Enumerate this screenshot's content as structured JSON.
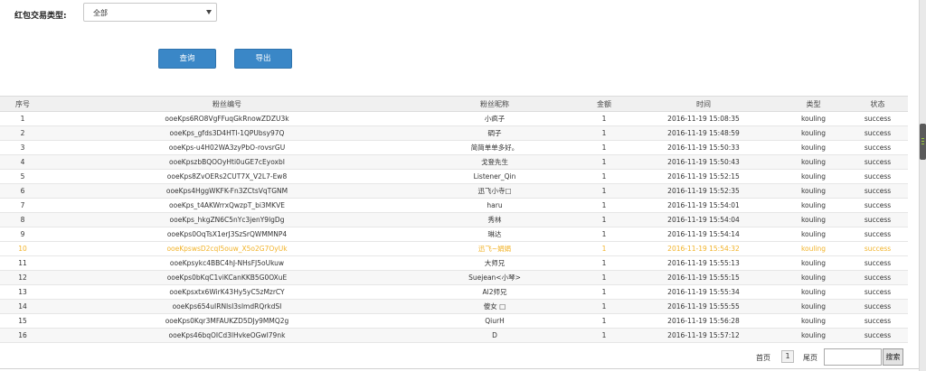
{
  "filter": {
    "label": "红包交易类型:",
    "select_value": "全部"
  },
  "buttons": {
    "query": "查询",
    "export": "导出"
  },
  "table": {
    "headers": [
      "序号",
      "粉丝编号",
      "粉丝昵称",
      "金额",
      "时间",
      "类型",
      "状态"
    ],
    "rows": [
      [
        "1",
        "ooeKps6RO8VgFFuqGkRnowZDZU3k",
        "小疯子",
        "1",
        "2016-11-19 15:08:35",
        "kouling",
        "success"
      ],
      [
        "2",
        "ooeKps_gfds3D4HTI-1QPUbsy97Q",
        "碉子",
        "1",
        "2016-11-19 15:48:59",
        "kouling",
        "success"
      ],
      [
        "3",
        "ooeKps-u4H02WA3zyPbO-rovsrGU",
        "简简单单多好。",
        "1",
        "2016-11-19 15:50:33",
        "kouling",
        "success"
      ],
      [
        "4",
        "ooeKpszbBQOOyHti0uGE7cEyoxbI",
        "戈登先生",
        "1",
        "2016-11-19 15:50:43",
        "kouling",
        "success"
      ],
      [
        "5",
        "ooeKps8ZvOERs2CUT7X_V2L7-Ew8",
        "Listener_Qin",
        "1",
        "2016-11-19 15:52:15",
        "kouling",
        "success"
      ],
      [
        "6",
        "ooeKps4HggWKFK-Fn3ZCtsVqTGNM",
        "迅飞小寺□",
        "1",
        "2016-11-19 15:52:35",
        "kouling",
        "success"
      ],
      [
        "7",
        "ooeKps_t4AKWrrxQwzpT_bi3MKVE",
        "haru",
        "1",
        "2016-11-19 15:54:01",
        "kouling",
        "success"
      ],
      [
        "8",
        "ooeKps_hkgZN6C5nYc3jenY9lgDg",
        "秀林",
        "1",
        "2016-11-19 15:54:04",
        "kouling",
        "success"
      ],
      [
        "9",
        "ooeKps0OqTsX1erJ3SzSrQWMMNP4",
        "琳达",
        "1",
        "2016-11-19 15:54:14",
        "kouling",
        "success"
      ],
      [
        "10",
        "ooeKpswsD2cqI5ouw_X5o2G7OyUk",
        "迅飞~娟娟",
        "1",
        "2016-11-19 15:54:32",
        "kouling",
        "success"
      ],
      [
        "11",
        "ooeKpsykc4BBC4hJ-NHsFJ5oUkuw",
        "大师兄",
        "1",
        "2016-11-19 15:55:13",
        "kouling",
        "success"
      ],
      [
        "12",
        "ooeKps0bKqC1viKCanKKB5G0OXuE",
        "Suejean<小琴>",
        "1",
        "2016-11-19 15:55:15",
        "kouling",
        "success"
      ],
      [
        "13",
        "ooeKpsxtx6WirK43Hy5yC5zMzrCY",
        "Al2师兄",
        "1",
        "2016-11-19 15:55:34",
        "kouling",
        "success"
      ],
      [
        "14",
        "ooeKps654uIRNlsI3slmdRQrkdSI",
        "傻女 □",
        "1",
        "2016-11-19 15:55:55",
        "kouling",
        "success"
      ],
      [
        "15",
        "ooeKps0Kqr3MFAUKZD5DJy9MMQ2g",
        "QiurH",
        "1",
        "2016-11-19 15:56:28",
        "kouling",
        "success"
      ],
      [
        "16",
        "ooeKps46bqOICd3lHvkeOGwI79nk",
        "D",
        "1",
        "2016-11-19 15:57:12",
        "kouling",
        "success"
      ]
    ],
    "highlighted_row": "10"
  },
  "pager": {
    "first": "首页",
    "current_page": "1",
    "last": "尾页",
    "jump_value": "",
    "search": "搜索"
  },
  "colors": {
    "button": "#3a87c7",
    "highlight_text": "#f2b32a",
    "header_bg": "#f0f0f0"
  }
}
